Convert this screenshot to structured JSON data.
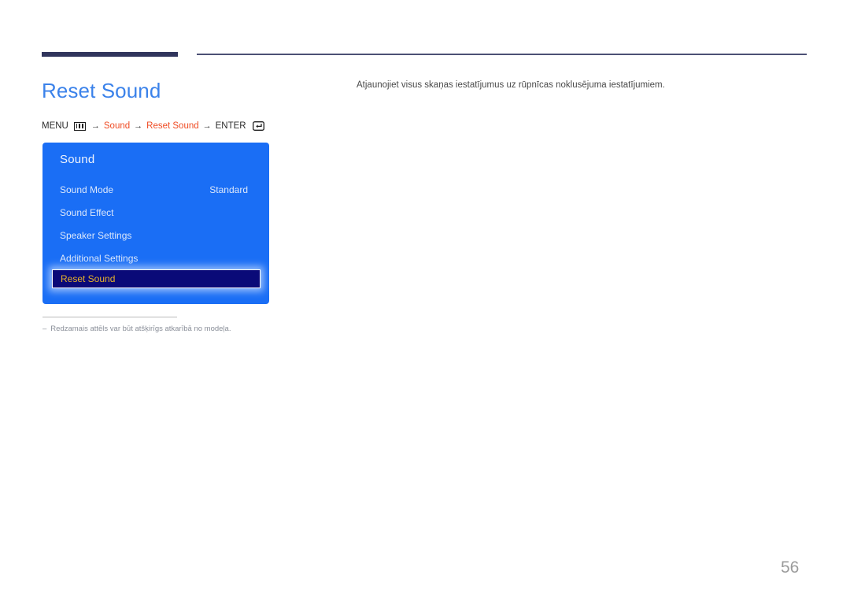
{
  "header": {
    "rule_thick_color": "#30355c",
    "rule_thin_color": "#4c5175"
  },
  "page_title": "Reset Sound",
  "description": "Atjaunojiet visus skaņas iestatījumus uz rūpnīcas noklusējuma iestatījumiem.",
  "menu_path": {
    "menu_label": "MENU",
    "menu_icon": "menu-grid-icon",
    "arrow1": "→",
    "segment_sound": "Sound",
    "arrow2": "→",
    "segment_reset_sound": "Reset Sound",
    "arrow3": "→",
    "enter_label": "ENTER",
    "enter_icon": "enter-return-icon",
    "highlight_color": "#ef4b23"
  },
  "osd": {
    "title": "Sound",
    "background_color": "#1a6ef5",
    "selected_background_color": "#0a0a78",
    "selected_text_color": "#e7b22a",
    "items": [
      {
        "label": "Sound Mode",
        "value": "Standard",
        "selected": false
      },
      {
        "label": "Sound Effect",
        "value": "",
        "selected": false
      },
      {
        "label": "Speaker Settings",
        "value": "",
        "selected": false
      },
      {
        "label": "Additional Settings",
        "value": "",
        "selected": false
      },
      {
        "label": "Reset Sound",
        "value": "",
        "selected": true
      }
    ]
  },
  "footnote": {
    "dash": "‒",
    "text": "Redzamais attēls var būt atšķirīgs atkarībā no modeļa."
  },
  "page_number": "56"
}
